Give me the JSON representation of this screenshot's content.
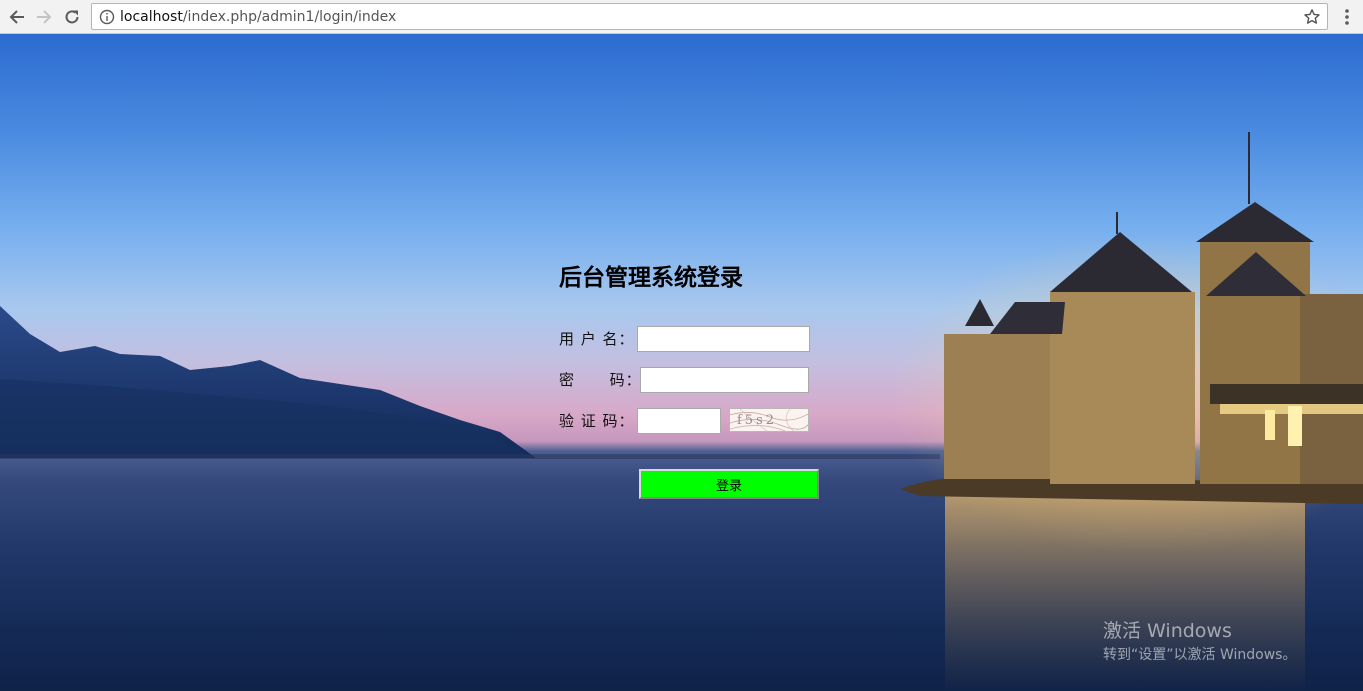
{
  "browser": {
    "url_host": "localhost",
    "url_path": "/index.php/admin1/login/index",
    "icons": [
      "back-arrow-icon",
      "forward-arrow-icon",
      "reload-icon",
      "info-icon",
      "bookmark-star-icon",
      "menu-dots-icon"
    ]
  },
  "login": {
    "title": "后台管理系统登录",
    "username_label": "用 户 名：",
    "username_value": "",
    "password_label": "密      码：",
    "password_value": "",
    "captcha_label": "验 证 码：",
    "captcha_value": "",
    "captcha_text": "f5s2",
    "submit_label": "登录",
    "submit_color": "#00ff00"
  },
  "watermark": {
    "title": "激活 Windows",
    "subtitle": "转到“设置”以激活 Windows。"
  }
}
